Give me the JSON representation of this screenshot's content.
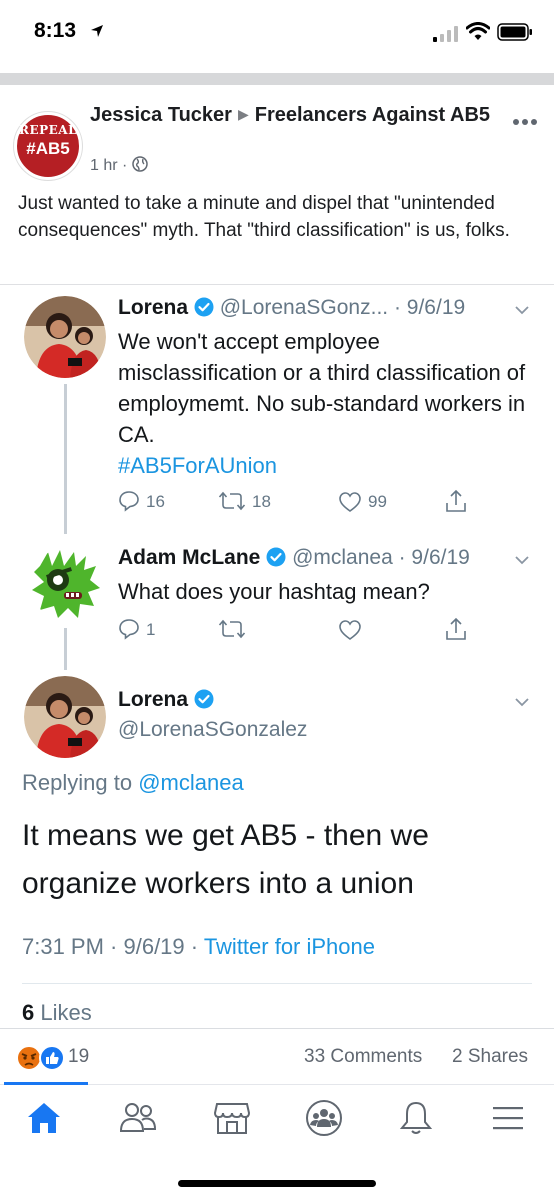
{
  "status_bar": {
    "time": "8:13"
  },
  "post": {
    "author": "Jessica Tucker",
    "group": "Freelancers Against AB5",
    "group_avatar": {
      "line1": "REPEAL",
      "line2": "#AB5"
    },
    "time_ago": "1 hr",
    "meta_separator": "·",
    "text": "Just wanted to take a minute and dispel that \"unintended consequences\" myth. That \"third classification\" is us, folks."
  },
  "tweets": [
    {
      "name": "Lorena",
      "handle": "@LorenaSGonz...",
      "date": "· 9/6/19",
      "text": "We won't accept employee misclassification or a third classification of employmemt. No sub-standard workers in CA.",
      "hashtag": "#AB5ForAUnion",
      "replies": "16",
      "retweets": "18",
      "likes": "99"
    },
    {
      "name": "Adam McLane",
      "handle": "@mclanea",
      "date": "· 9/6/19",
      "text": "What does your hashtag mean?",
      "replies": "1",
      "retweets": "",
      "likes": ""
    }
  ],
  "main_tweet": {
    "name": "Lorena",
    "handle": "@LorenaSGonzalez",
    "replying_prefix": "Replying to",
    "replying_to": "@mclanea",
    "text": "It means we get AB5 - then we organize workers into a union",
    "time": "7:31 PM · 9/6/19 ·",
    "source": "Twitter for iPhone",
    "likes_count": "6",
    "likes_label": "Likes"
  },
  "reactions": {
    "count": "19",
    "comments": "33 Comments",
    "shares": "2 Shares"
  },
  "tabs": [
    "home-icon",
    "friends-icon",
    "marketplace-icon",
    "groups-icon",
    "notifications-icon",
    "menu-icon"
  ],
  "colors": {
    "facebook_blue": "#1877f2",
    "twitter_blue": "#1b95e0",
    "group_red": "#b51f24"
  }
}
